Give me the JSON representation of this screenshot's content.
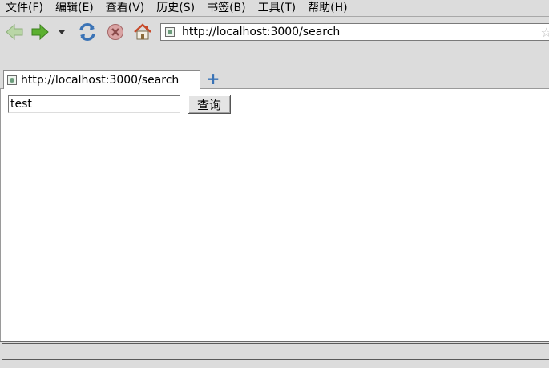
{
  "menu": [
    "文件(F)",
    "编辑(E)",
    "查看(V)",
    "历史(S)",
    "书签(B)",
    "工具(T)",
    "帮助(H)"
  ],
  "nav": {
    "back_icon": "back-arrow-icon",
    "forward_icon": "forward-arrow-icon",
    "history_dropdown_icon": "chevron-down-icon",
    "reload_icon": "reload-icon",
    "stop_icon": "stop-icon",
    "home_icon": "home-icon"
  },
  "urlbar": {
    "value": "http://localhost:3000/search"
  },
  "tabs": [
    {
      "title": "http://localhost:3000/search"
    }
  ],
  "newtab_label": "+",
  "page": {
    "search_value": "test",
    "submit_label": "查询"
  },
  "colors": {
    "chrome": "#dcdcdc",
    "accent_blue": "#3a73b6",
    "go_green": "#5cb030"
  }
}
